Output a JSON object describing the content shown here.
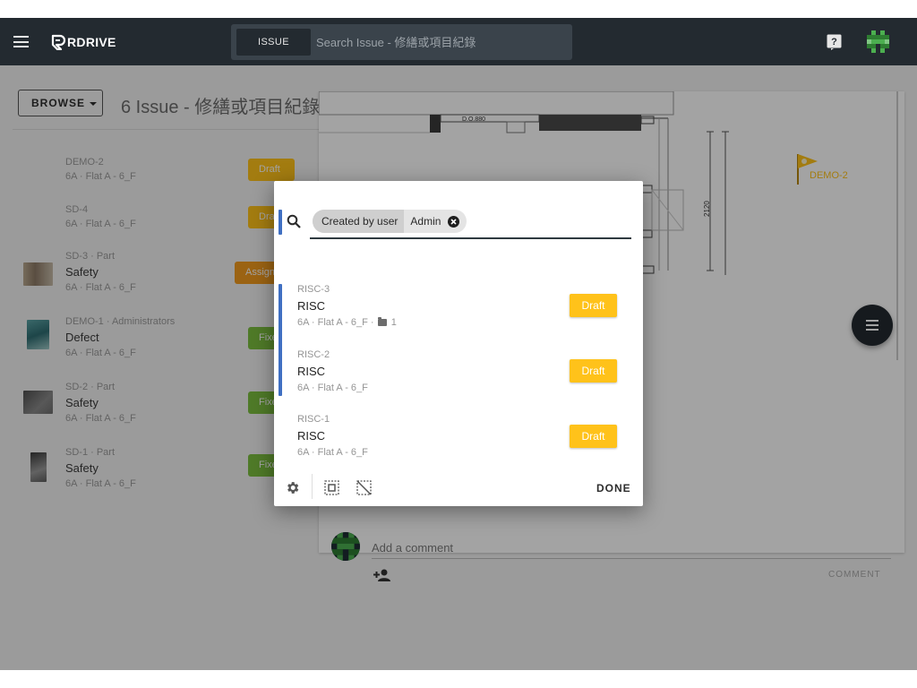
{
  "app": {
    "brand": "RDRIVE"
  },
  "topbar": {
    "search_tab_label": "ISSUE",
    "search_placeholder": "Search Issue - 修繕或項目紀錄"
  },
  "page": {
    "browse_label": "BROWSE",
    "title": "6 Issue - 修繕或項目紀錄"
  },
  "issues": [
    {
      "meta": "DEMO-2",
      "title": "",
      "location": "6A · Flat A - 6_F",
      "status": "Draft",
      "status_color": "#ffc21a"
    },
    {
      "meta": "SD-4",
      "title": "",
      "location": "6A · Flat A - 6_F",
      "status": "Draft",
      "status_color": "#ffc21a"
    },
    {
      "meta": "SD-3 · Part",
      "title": "Safety",
      "location": "6A · Flat A - 6_F",
      "status": "Assigned",
      "status_color": "#f39b1e"
    },
    {
      "meta": "DEMO-1 · Administrators",
      "title": "Defect",
      "location": "6A · Flat A - 6_F",
      "status": "Fixed",
      "status_color": "#7cbf3f"
    },
    {
      "meta": "SD-2 · Part",
      "title": "Safety",
      "location": "6A · Flat A - 6_F",
      "status": "Fixed",
      "status_color": "#7cbf3f"
    },
    {
      "meta": "SD-1 · Part",
      "title": "Safety",
      "location": "6A · Flat A - 6_F",
      "status": "Fixed",
      "status_color": "#7cbf3f"
    }
  ],
  "drawing": {
    "label_door": "D.O.880",
    "dimension": "2120",
    "pin_label": "DEMO-2"
  },
  "comment": {
    "placeholder": "Add a comment",
    "button": "COMMENT"
  },
  "dialog": {
    "filter_label": "Created by user",
    "filter_value": "Admin",
    "results": [
      {
        "id": "RISC-3",
        "title": "RISC",
        "location": "6A · Flat A - 6_F ·",
        "folder_count": "1",
        "status": "Draft"
      },
      {
        "id": "RISC-2",
        "title": "RISC",
        "location": "6A · Flat A - 6_F",
        "folder_count": "",
        "status": "Draft"
      },
      {
        "id": "RISC-1",
        "title": "RISC",
        "location": "6A · Flat A - 6_F",
        "folder_count": "",
        "status": "Draft"
      }
    ],
    "done_label": "DONE"
  },
  "colors": {
    "appbar": "#232a30",
    "accent": "#3f6fc2",
    "draft": "#ffc21a",
    "fixed": "#7cbf3f",
    "assigned": "#f39b1e"
  }
}
